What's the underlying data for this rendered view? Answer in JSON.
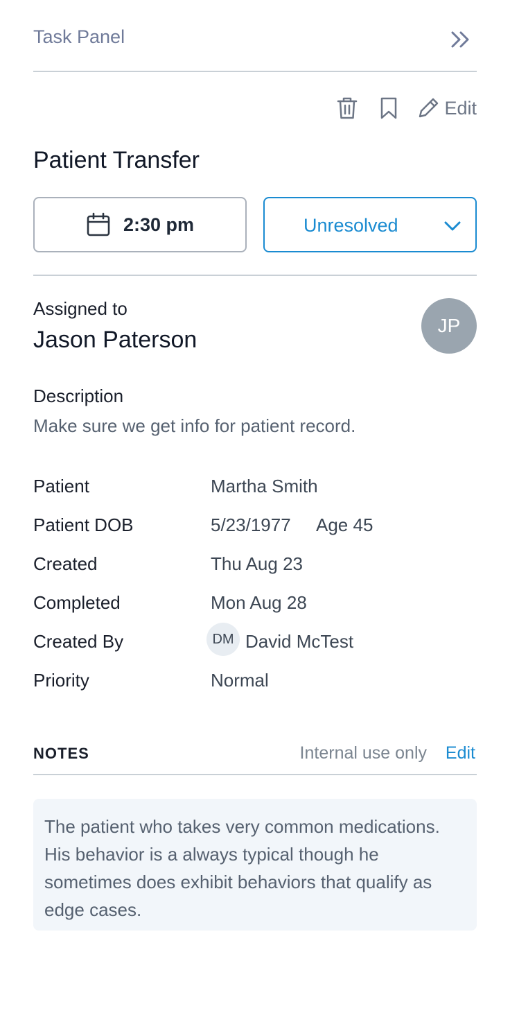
{
  "header": {
    "title": "Task Panel"
  },
  "toolbar": {
    "edit_label": "Edit"
  },
  "task": {
    "title": "Patient Transfer",
    "time": "2:30 pm",
    "status": "Unresolved"
  },
  "assignee": {
    "label": "Assigned to",
    "name": "Jason Paterson",
    "initials": "JP"
  },
  "description": {
    "label": "Description",
    "text": "Make sure we get info for patient record."
  },
  "details": {
    "patient_label": "Patient",
    "patient_value": "Martha Smith",
    "dob_label": "Patient DOB",
    "dob_value": "5/23/1977",
    "age_value": "Age 45",
    "created_label": "Created",
    "created_value": "Thu Aug 23",
    "completed_label": "Completed",
    "completed_value": "Mon Aug 28",
    "created_by_label": "Created By",
    "created_by_initials": "DM",
    "created_by_value": "David McTest",
    "priority_label": "Priority",
    "priority_value": "Normal"
  },
  "notes": {
    "label": "NOTES",
    "hint": "Internal use only",
    "edit_label": "Edit",
    "text": "The patient who takes very common medications. His behavior is a always typical though he sometimes does exhibit behaviors that qualify as edge cases."
  },
  "colors": {
    "accent": "#1a8bd1",
    "avatar": "#9aa5af",
    "notes_bg": "#f2f6fa"
  }
}
